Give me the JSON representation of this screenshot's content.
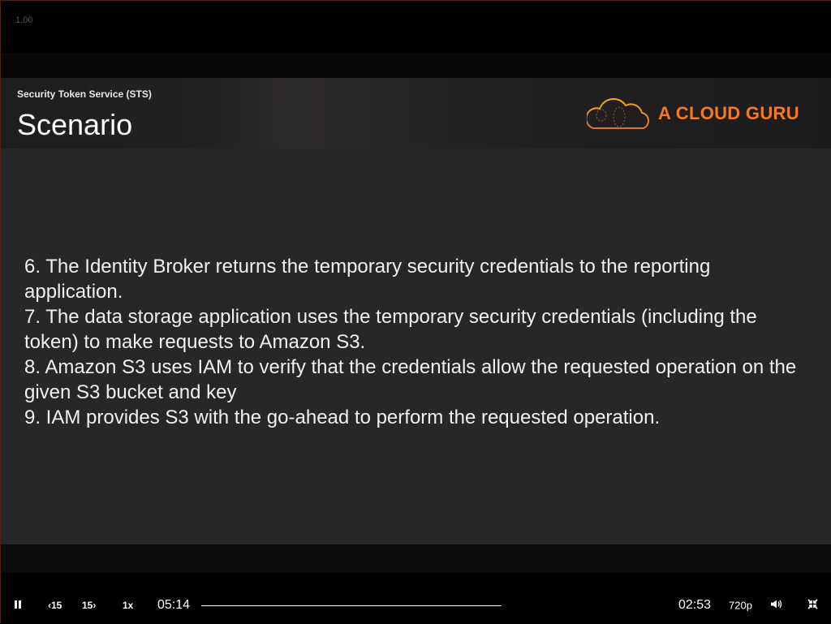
{
  "player": {
    "playback_rate_readout": "1.00"
  },
  "slide": {
    "subtitle": "Security Token Service (STS)",
    "title": "Scenario",
    "logo_text": "A CLOUD GURU",
    "brand_color": "#f27a25",
    "lines": [
      "6.  The Identity Broker returns the temporary security credentials to the reporting application.",
      "7.  The data storage application uses the temporary security credentials (including the token) to make requests to Amazon S3.",
      "8.  Amazon S3 uses IAM to verify that the credentials allow the requested operation on the given S3 bucket and key",
      "9.  IAM provides S3 with the go-ahead to perform the requested operation."
    ]
  },
  "controls": {
    "pause_icon": "pause-icon",
    "rewind_label": "‹15",
    "forward_label": "15›",
    "speed_label": "1x",
    "elapsed": "05:14",
    "remaining": "02:53",
    "quality": "720p",
    "volume_icon": "volume-icon",
    "exit_fullscreen_icon": "exit-fullscreen-icon"
  }
}
